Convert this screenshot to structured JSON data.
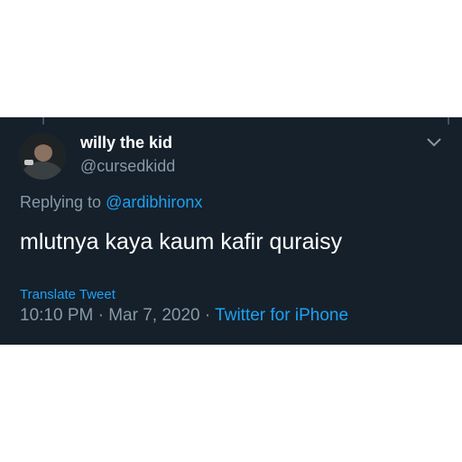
{
  "tweet": {
    "author_name": "willy the kid",
    "author_handle": "@cursedkidd",
    "reply_prefix": "Replying to",
    "reply_to": "@ardibhironx",
    "text": "mlutnya kaya kaum kafir quraisy",
    "translate_label": "Translate Tweet",
    "time": "10:10 PM",
    "separator": "·",
    "date": "Mar 7, 2020",
    "source": "Twitter for iPhone"
  },
  "icons": {
    "menu": "chevron-down-icon",
    "avatar": "avatar"
  },
  "colors": {
    "background": "#15202b",
    "primary_text": "#ffffff",
    "secondary_text": "#8899a6",
    "link": "#1da1f2"
  }
}
